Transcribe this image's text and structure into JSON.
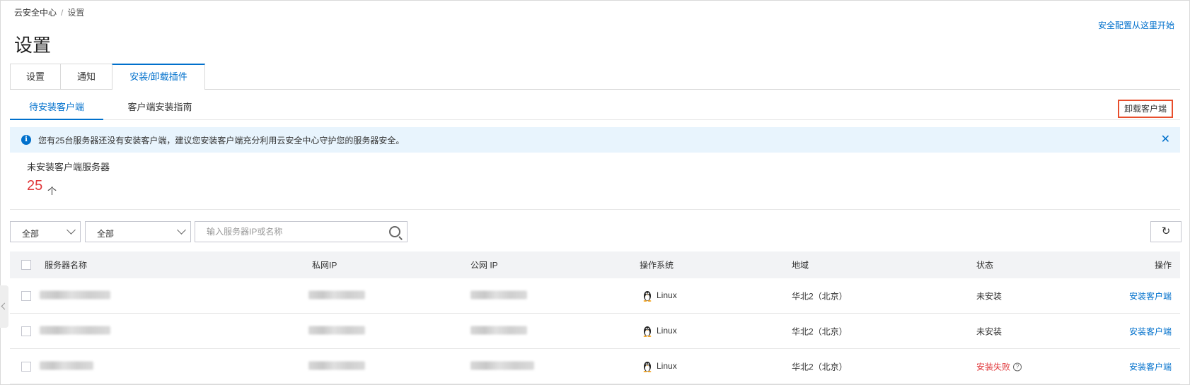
{
  "breadcrumb": {
    "root": "云安全中心",
    "separator": "/",
    "current": "设置"
  },
  "page": {
    "title": "设置",
    "start_link": "安全配置从这里开始"
  },
  "tabs": [
    {
      "label": "设置"
    },
    {
      "label": "通知"
    },
    {
      "label": "安装/卸载插件",
      "active": true
    }
  ],
  "subtabs": [
    {
      "label": "待安装客户端",
      "active": true
    },
    {
      "label": "客户端安装指南"
    }
  ],
  "uninstall_button": "卸载客户端",
  "alert": {
    "text": "您有25台服务器还没有安装客户端，建议您安装客户端充分利用云安全中心守护您的服务器安全。",
    "info_icon": "i",
    "close_icon": "✕"
  },
  "stat": {
    "label": "未安装客户端服务器",
    "value": "25",
    "unit": "个"
  },
  "filters": {
    "select1": "全部",
    "select2": "全部",
    "search_placeholder": "输入服务器IP或名称",
    "refresh_icon": "↻"
  },
  "table": {
    "columns": [
      "服务器名称",
      "私网IP",
      "公网 IP",
      "操作系统",
      "地域",
      "状态",
      "操作"
    ],
    "rows": [
      {
        "os": "Linux",
        "region": "华北2（北京）",
        "status": "未安装",
        "status_type": "normal",
        "action": "安装客户端"
      },
      {
        "os": "Linux",
        "region": "华北2（北京）",
        "status": "未安装",
        "status_type": "normal",
        "action": "安装客户端"
      },
      {
        "os": "Linux",
        "region": "华北2（北京）",
        "status": "安装失败",
        "status_type": "fail",
        "action": "安装客户端"
      }
    ],
    "help_icon": "?"
  },
  "colors": {
    "accent": "#0070cc",
    "danger": "#e0373a",
    "highlight_border": "#e84e2c",
    "alert_bg": "#e8f4fd"
  }
}
